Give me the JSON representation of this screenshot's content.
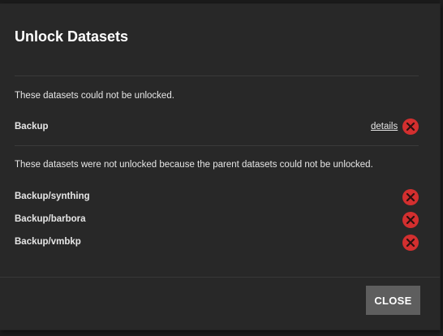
{
  "dialog": {
    "title": "Unlock Datasets",
    "failed_message": "These datasets could not be unlocked.",
    "failed_datasets": [
      {
        "name": "Backup",
        "details_label": "details",
        "status_icon": "error-icon"
      }
    ],
    "parent_failed_message": "These datasets were not unlocked because the parent datasets could not be unlocked.",
    "parent_failed_datasets": [
      {
        "name": "Backup/synthing",
        "status_icon": "error-icon"
      },
      {
        "name": "Backup/barbora",
        "status_icon": "error-icon"
      },
      {
        "name": "Backup/vmbkp",
        "status_icon": "error-icon"
      }
    ],
    "close_label": "CLOSE"
  },
  "colors": {
    "background": "#282828",
    "error_red": "#d32f2f",
    "button_bg": "#5e5e5e",
    "text": "#e6e6e6"
  }
}
